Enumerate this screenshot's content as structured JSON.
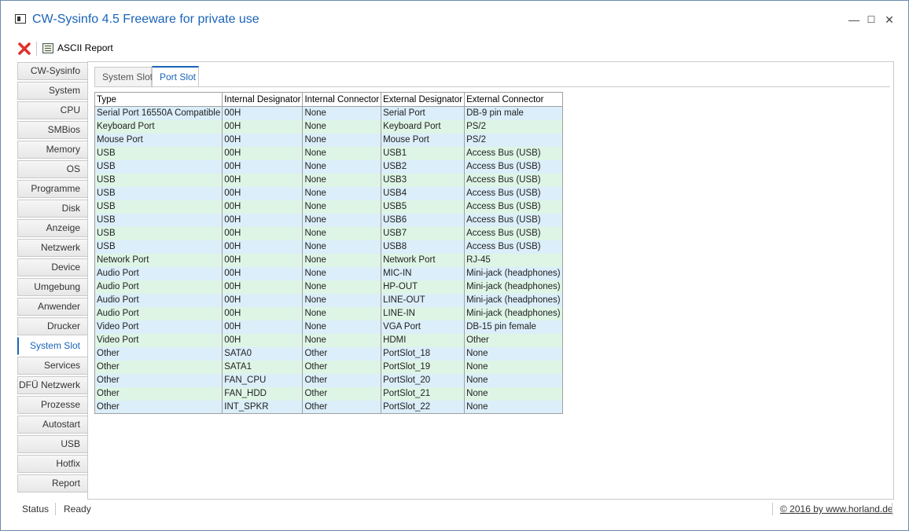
{
  "window": {
    "title": "CW-Sysinfo 4.5 Freeware for private use",
    "minimize": "—",
    "maximize": "☐",
    "close": "✕"
  },
  "toolbar": {
    "ascii_report": "ASCII Report"
  },
  "nav": {
    "items": [
      "CW-Sysinfo",
      "System",
      "CPU",
      "SMBios",
      "Memory",
      "OS",
      "Programme",
      "Disk",
      "Anzeige",
      "Netzwerk",
      "Device",
      "Umgebung",
      "Anwender",
      "Drucker",
      "System Slot",
      "Services",
      "DFÜ Netzwerk",
      "Prozesse",
      "Autostart",
      "USB",
      "Hotfix",
      "Report"
    ],
    "active": "System Slot"
  },
  "tabs": {
    "items": [
      "System Slot",
      "Port Slot"
    ],
    "active": "Port Slot"
  },
  "grid": {
    "columns": [
      "Type",
      "Internal Designator",
      "Internal Connector",
      "External Designator",
      "External Connector"
    ],
    "rows": [
      [
        "Serial Port 16550A Compatible",
        "00H",
        "None",
        "Serial Port",
        "DB-9 pin male"
      ],
      [
        "Keyboard Port",
        "00H",
        "None",
        "Keyboard Port",
        "PS/2"
      ],
      [
        "Mouse Port",
        "00H",
        "None",
        "Mouse Port",
        "PS/2"
      ],
      [
        "USB",
        "00H",
        "None",
        "USB1",
        "Access Bus (USB)"
      ],
      [
        "USB",
        "00H",
        "None",
        "USB2",
        "Access Bus (USB)"
      ],
      [
        "USB",
        "00H",
        "None",
        "USB3",
        "Access Bus (USB)"
      ],
      [
        "USB",
        "00H",
        "None",
        "USB4",
        "Access Bus (USB)"
      ],
      [
        "USB",
        "00H",
        "None",
        "USB5",
        "Access Bus (USB)"
      ],
      [
        "USB",
        "00H",
        "None",
        "USB6",
        "Access Bus (USB)"
      ],
      [
        "USB",
        "00H",
        "None",
        "USB7",
        "Access Bus (USB)"
      ],
      [
        "USB",
        "00H",
        "None",
        "USB8",
        "Access Bus (USB)"
      ],
      [
        "Network Port",
        "00H",
        "None",
        "Network Port",
        "RJ-45"
      ],
      [
        "Audio Port",
        "00H",
        "None",
        "MIC-IN",
        "Mini-jack (headphones)"
      ],
      [
        "Audio Port",
        "00H",
        "None",
        "HP-OUT",
        "Mini-jack (headphones)"
      ],
      [
        "Audio Port",
        "00H",
        "None",
        "LINE-OUT",
        "Mini-jack (headphones)"
      ],
      [
        "Audio Port",
        "00H",
        "None",
        "LINE-IN",
        "Mini-jack (headphones)"
      ],
      [
        "Video Port",
        "00H",
        "None",
        "VGA Port",
        "DB-15 pin female"
      ],
      [
        "Video Port",
        "00H",
        "None",
        "HDMI",
        "Other"
      ],
      [
        "Other",
        "SATA0",
        "Other",
        "PortSlot_18",
        "None"
      ],
      [
        "Other",
        "SATA1",
        "Other",
        "PortSlot_19",
        "None"
      ],
      [
        "Other",
        "FAN_CPU",
        "Other",
        "PortSlot_20",
        "None"
      ],
      [
        "Other",
        "FAN_HDD",
        "Other",
        "PortSlot_21",
        "None"
      ],
      [
        "Other",
        "INT_SPKR",
        "Other",
        "PortSlot_22",
        "None"
      ]
    ]
  },
  "status": {
    "label": "Status",
    "value": "Ready",
    "copyright": "© 2016 by www.horland.de"
  },
  "colors": {
    "accent": "#1a64b8",
    "row_blue": "#dbeefa",
    "row_green": "#def5e5",
    "close_red": "#e0302a"
  }
}
